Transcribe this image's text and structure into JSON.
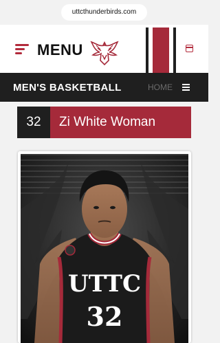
{
  "browser": {
    "url": "uttcthunderbirds.com"
  },
  "header": {
    "menu_label": "MENU",
    "logo_icon": "thunderbird-logo-icon",
    "calendar_icon": "calendar-icon",
    "stripe_colors": [
      "#1f1f1f",
      "#ffffff",
      "#a52a3a"
    ]
  },
  "nav": {
    "title": "MEN'S BASKETBALL",
    "home_label": "HOME",
    "menu_icon": "menu-icon"
  },
  "player": {
    "number": "32",
    "name": "Zi White Woman",
    "jersey_text": "UTTC",
    "jersey_number": "32"
  },
  "colors": {
    "accent": "#a52a3a",
    "dark": "#1f1f1f"
  }
}
